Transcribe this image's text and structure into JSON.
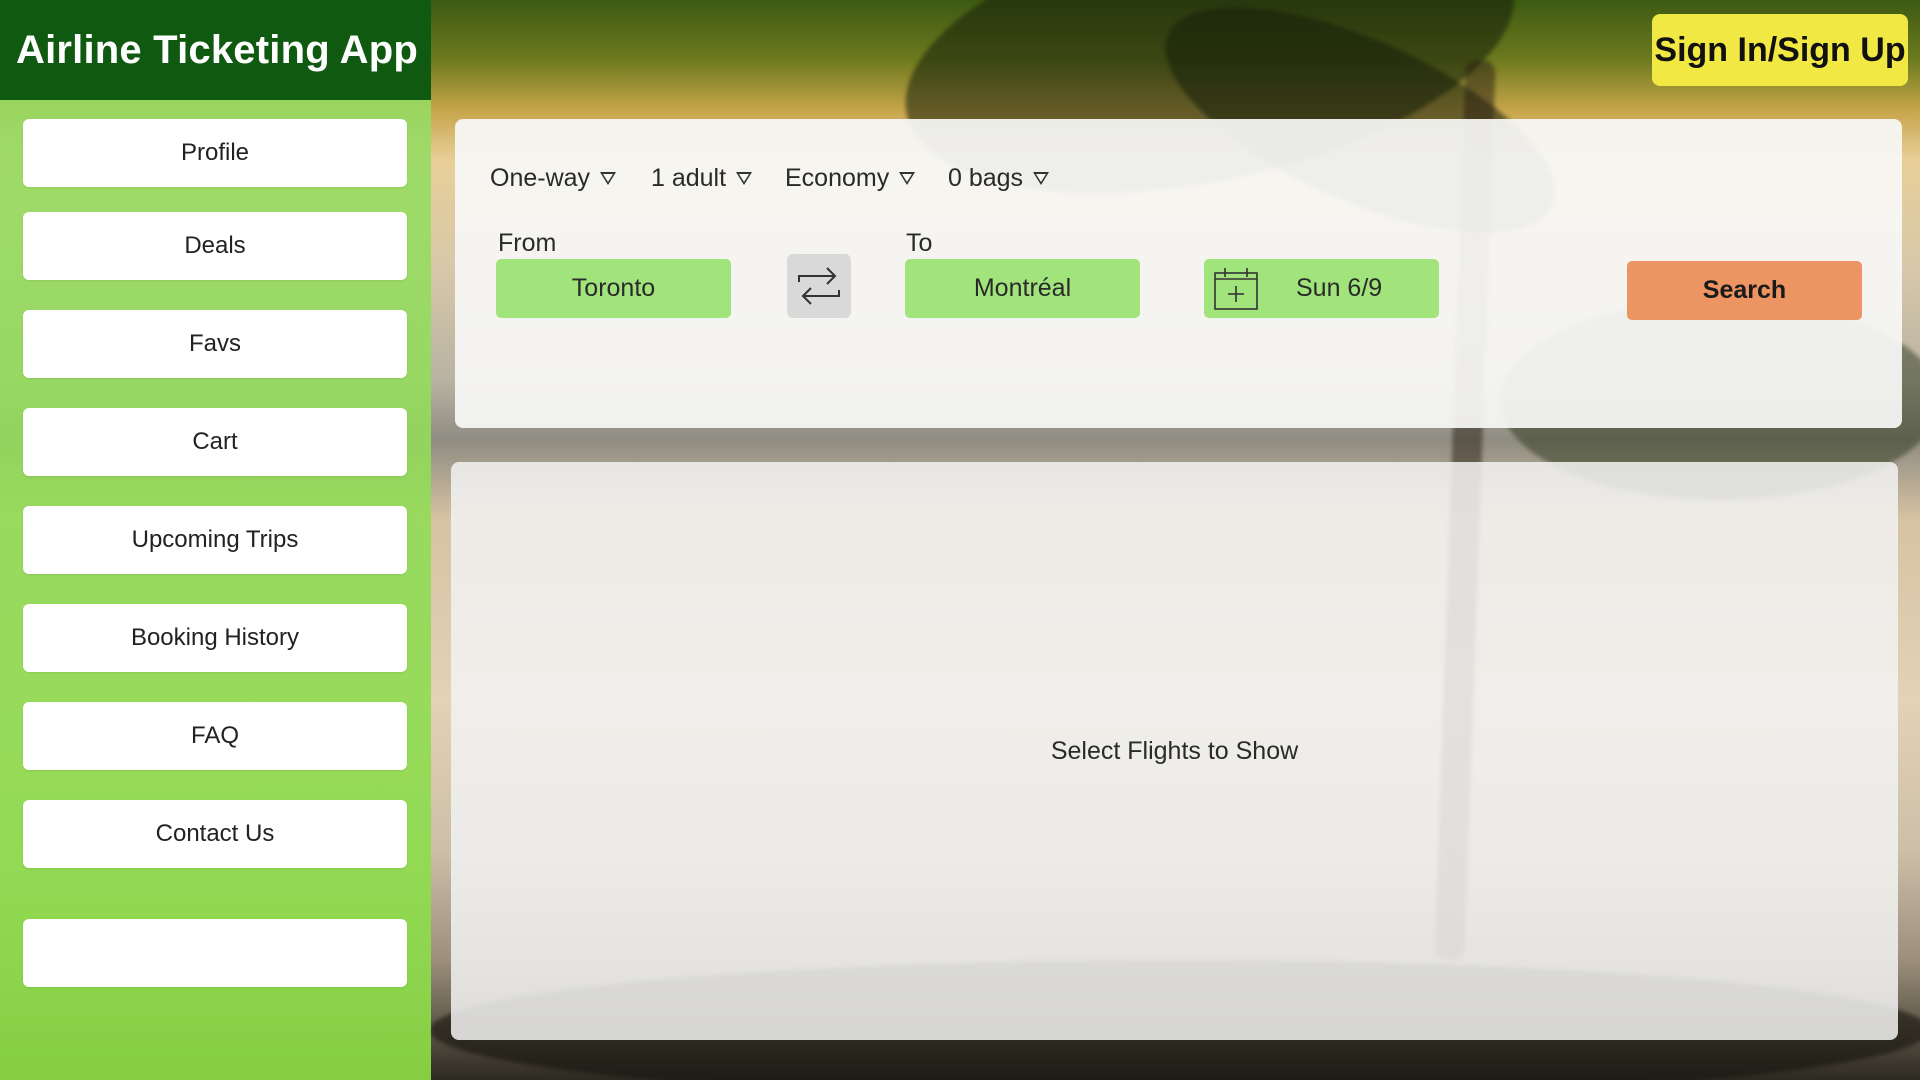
{
  "app": {
    "title": "Airline Ticketing App"
  },
  "header": {
    "signin_label": "Sign In/Sign Up"
  },
  "sidebar": {
    "items": [
      {
        "label": "Profile"
      },
      {
        "label": "Deals"
      },
      {
        "label": "Favs"
      },
      {
        "label": "Cart"
      },
      {
        "label": "Upcoming Trips"
      },
      {
        "label": "Booking History"
      },
      {
        "label": "FAQ"
      },
      {
        "label": "Contact Us"
      },
      {
        "label": ""
      }
    ]
  },
  "search": {
    "trip_type": "One-way",
    "passengers": "1 adult",
    "cabin_class": "Economy",
    "bags": "0 bags",
    "from_label": "From",
    "from_value": "Toronto",
    "to_label": "To",
    "to_value": "Montréal",
    "date_value": "Sun 6/9",
    "search_label": "Search",
    "swap_icon": "swap-arrows-icon",
    "calendar_icon": "calendar-add-icon"
  },
  "results": {
    "empty_message": "Select Flights to Show"
  },
  "colors": {
    "header_bg": "#0f5a10",
    "signin_bg": "#f2e844",
    "sidebar_bg": "#9be46a",
    "field_bg": "#a1e47b",
    "search_bg": "#ec9462"
  }
}
